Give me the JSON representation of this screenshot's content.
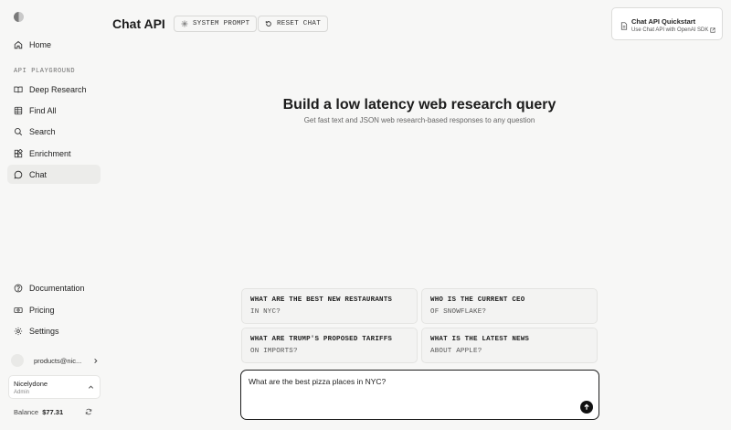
{
  "sidebar": {
    "nav_top": [
      {
        "label": "Home",
        "icon": "home-icon"
      }
    ],
    "section_label": "API PLAYGROUND",
    "playground_items": [
      {
        "label": "Deep Research",
        "icon": "book-open-icon"
      },
      {
        "label": "Find All",
        "icon": "table-icon"
      },
      {
        "label": "Search",
        "icon": "search-icon"
      },
      {
        "label": "Enrichment",
        "icon": "puzzle-icon"
      },
      {
        "label": "Chat",
        "icon": "chat-bubble-icon",
        "active": true
      }
    ],
    "bottom_items": [
      {
        "label": "Documentation",
        "icon": "help-circle-icon"
      },
      {
        "label": "Pricing",
        "icon": "currency-icon"
      },
      {
        "label": "Settings",
        "icon": "gear-icon"
      }
    ],
    "account_email": "products@nic...",
    "workspace": {
      "name": "Nicelydone",
      "role": "Admin"
    },
    "balance": {
      "label": "Balance",
      "amount": "$77.31"
    }
  },
  "header": {
    "title": "Chat API",
    "system_prompt_label": "SYSTEM PROMPT",
    "reset_chat_label": "RESET CHAT"
  },
  "quickstart": {
    "title": "Chat API Quickstart",
    "subtitle": "Use Chat API with OpenAI SDK"
  },
  "hero": {
    "title": "Build a low latency web research query",
    "subtitle": "Get fast text and JSON web research-based responses to any question"
  },
  "suggestions": [
    {
      "line1": "WHAT ARE THE BEST NEW RESTAURANTS",
      "line2": "IN NYC?"
    },
    {
      "line1": "WHO IS THE CURRENT CEO",
      "line2": "OF SNOWFLAKE?"
    },
    {
      "line1": "WHAT ARE TRUMP'S PROPOSED TARIFFS",
      "line2": "ON IMPORTS?"
    },
    {
      "line1": "WHAT IS THE LATEST NEWS",
      "line2": "ABOUT APPLE?"
    }
  ],
  "composer": {
    "value": "What are the best pizza places in NYC?"
  },
  "colors": {
    "background": "#f7f7f6",
    "accent": "#111111",
    "active_nav": "#ececea"
  }
}
